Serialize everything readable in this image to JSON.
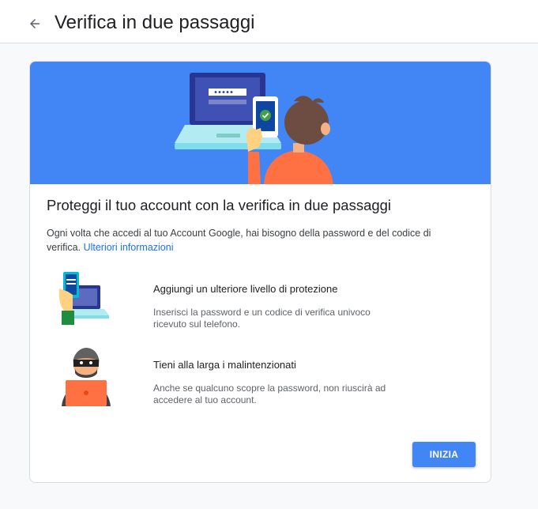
{
  "header": {
    "title": "Verifica in due passaggi",
    "back_icon": "arrow-back-icon"
  },
  "card": {
    "heading": "Proteggi il tuo account con la verifica in due passaggi",
    "intro_text": "Ogni volta che accedi al tuo Account Google, hai bisogno della password e del codice di verifica.",
    "learn_more_link": "Ulteriori informazioni",
    "features": [
      {
        "title": "Aggiungi un ulteriore livello di protezione",
        "description": "Inserisci la password e un codice di verifica univoco ricevuto sul telefono.",
        "icon": "phone-laptop-illustration"
      },
      {
        "title": "Tieni alla larga i malintenzionati",
        "description": "Anche se qualcuno scopre la password, non riuscirà ad accedere al tuo account.",
        "icon": "hacker-illustration"
      }
    ],
    "start_button": "INIZIA"
  },
  "colors": {
    "hero_blue": "#4285f4",
    "link_blue": "#1a73e8",
    "button_blue": "#4285f4"
  }
}
